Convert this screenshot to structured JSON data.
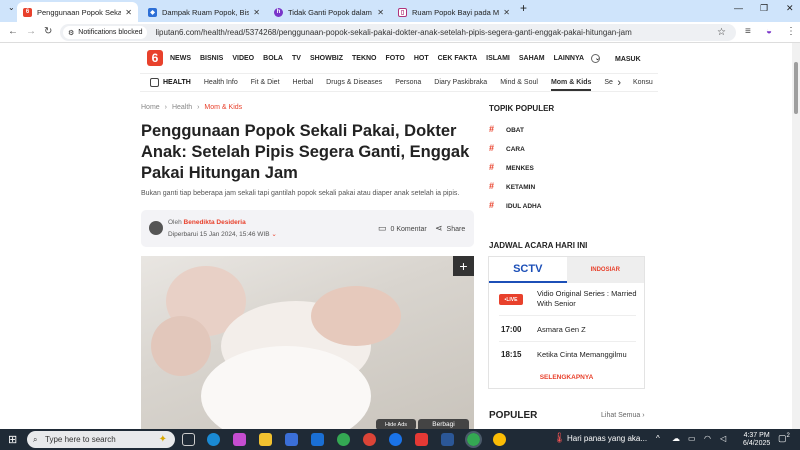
{
  "browser": {
    "tabs": [
      {
        "title": "Penggunaan Popok Sekali Paka",
        "active": true,
        "color": "#e8412c"
      },
      {
        "title": "Dampak Ruam Popok, Bisa Han",
        "active": false,
        "color": "#2d6fd6"
      },
      {
        "title": "Tidak Ganti Popok dalam Wakt",
        "active": false,
        "color": "#7a35c9"
      },
      {
        "title": "Ruam Popok Bayi pada Musim",
        "active": false,
        "color": "#b0327a"
      }
    ],
    "new_tab": "+",
    "notifications_blocked": "Notifications blocked",
    "url": "liputan6.com/health/read/5374268/penggunaan-popok-sekali-pakai-dokter-anak-setelah-pipis-segera-ganti-enggak-pakai-hitungan-jam"
  },
  "site": {
    "logo": "6",
    "nav": [
      "NEWS",
      "BISNIS",
      "VIDEO",
      "BOLA",
      "TV",
      "SHOWBIZ",
      "TEKNO",
      "FOTO",
      "HOT",
      "CEK FAKTA",
      "ISLAMI",
      "SAHAM",
      "LAINNYA"
    ],
    "masuk": "MASUK",
    "subnav_section": "HEALTH",
    "subnav": [
      "Health Info",
      "Fit & Diet",
      "Herbal",
      "Drugs & Diseases",
      "Persona",
      "Diary Paskibraka",
      "Mind & Soul",
      "Mom & Kids",
      "Seks",
      "Konsu"
    ],
    "subnav_active": "Mom & Kids"
  },
  "article": {
    "breadcrumb": [
      "Home",
      "Health",
      "Mom & Kids"
    ],
    "title": "Penggunaan Popok Sekali Pakai, Dokter Anak: Setelah Pipis Segera Ganti, Enggak Pakai Hitungan Jam",
    "lead": "Bukan ganti tiap beberapa jam sekali tapi gantilah popok sekali pakai atau diaper anak setelah ia pipis.",
    "oleh": "Oleh",
    "author": "Benedikta Desideria",
    "updated": "Diperbarui 15 Jan 2024, 15:46 WIB",
    "komentar": "0 Komentar",
    "share": "Share",
    "hide_ads": "Hide Ads",
    "berbagi": "Berbagi"
  },
  "sidebar": {
    "topik_title": "TOPIK POPULER",
    "topik": [
      "OBAT",
      "CARA",
      "MENKES",
      "KETAMIN",
      "IDUL ADHA"
    ],
    "jadwal_title": "JADWAL ACARA HARI INI",
    "channels": [
      "SCTV",
      "INDOSIAR"
    ],
    "live_label": "LIVE",
    "schedule": [
      {
        "time": "LIVE",
        "name": "Vidio Original Series : Married With Senior"
      },
      {
        "time": "17:00",
        "name": "Asmara Gen Z"
      },
      {
        "time": "18:15",
        "name": "Ketika Cinta Memanggilmu"
      }
    ],
    "selengkapnya": "SELENGKAPNYA",
    "populer": "POPULER",
    "lihat_semua": "Lihat Semua"
  },
  "taskbar": {
    "search_placeholder": "Type here to search",
    "weather": "Hari panas yang aka...",
    "time": "4:37 PM",
    "date": "6/4/2025",
    "badge": "2"
  }
}
